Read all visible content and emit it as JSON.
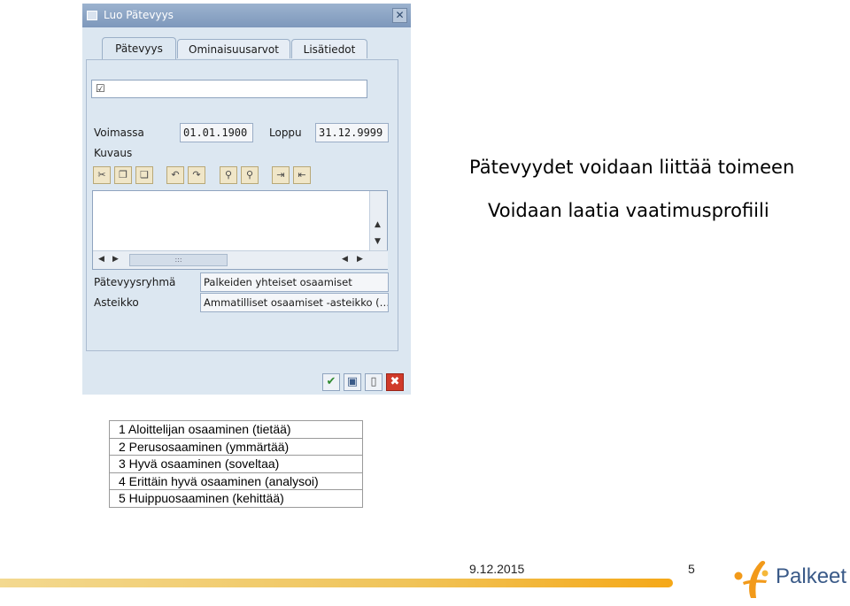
{
  "dialog": {
    "title": "Luo Pätevyys",
    "tabs": [
      {
        "label": "Pätevyys",
        "active": true
      },
      {
        "label": "Ominaisuusarvot",
        "active": false
      },
      {
        "label": "Lisätiedot",
        "active": false
      }
    ],
    "valid_label": "Voimassa",
    "valid_from": "01.01.1900",
    "end_label": "Loppu",
    "valid_to": "31.12.9999",
    "description_label": "Kuvaus",
    "group_label": "Pätevyysryhmä",
    "group_value": "Palkeiden yhteiset osaamiset",
    "scale_label": "Asteikko",
    "scale_value": "Ammatilliset osaamiset -asteikko (…"
  },
  "headings": {
    "line1": "Pätevyydet voidaan liittää toimeen",
    "line2": "Voidaan laatia vaatimusprofiili"
  },
  "scale_levels": [
    "1 Aloittelijan osaaminen (tietää)",
    "2 Perusosaaminen (ymmärtää)",
    "3 Hyvä osaaminen (soveltaa)",
    "4 Erittäin hyvä osaaminen (analysoi)",
    "5 Huippuosaaminen (kehittää)"
  ],
  "footer": {
    "date": "9.12.2015",
    "page": "5",
    "logo_text": "Palkeet"
  },
  "colors": {
    "dialog_bg": "#dce7f1",
    "titlebar": "#7d98bb",
    "footer_accent": "#f0c45a",
    "logo_orange": "#f29a1a",
    "logo_blue": "#3a5a88"
  }
}
